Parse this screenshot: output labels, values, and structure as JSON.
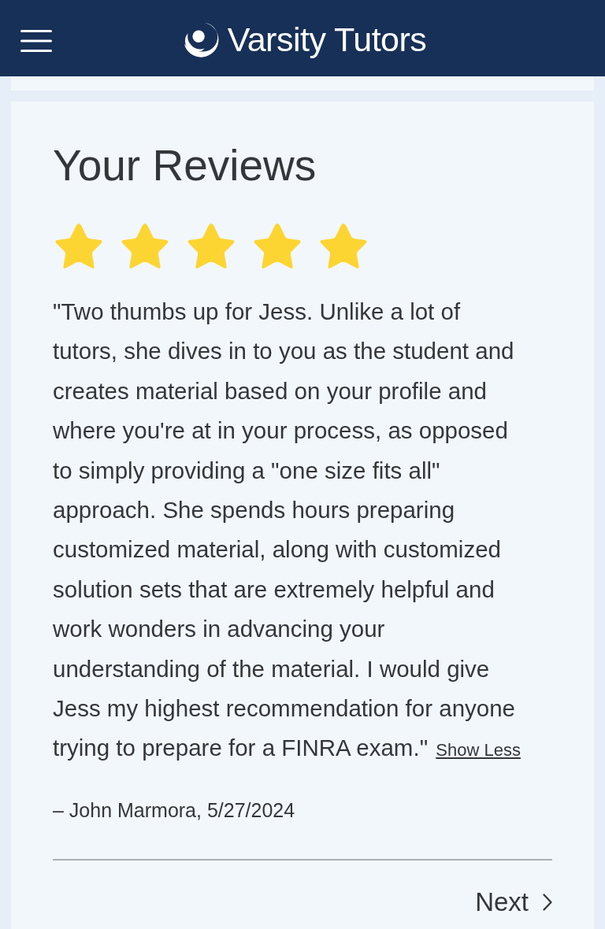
{
  "header": {
    "logo_text": "Varsity Tutors"
  },
  "reviews": {
    "title": "Your Reviews",
    "stars": 5,
    "text": "\"Two thumbs up for Jess. Unlike a lot of tutors, she dives in to you as the student and creates material based on your profile and where you're at in your process, as opposed to simply providing a \"one size fits all\" approach. She spends hours preparing customized material, along with customized solution sets that are extremely helpful and work wonders in advancing your understanding of the material. I would give Jess my highest recommendation for anyone trying to prepare for a FINRA exam.\"",
    "show_less": "Show Less",
    "author": "– John Marmora, 5/27/2024",
    "next": "Next"
  }
}
